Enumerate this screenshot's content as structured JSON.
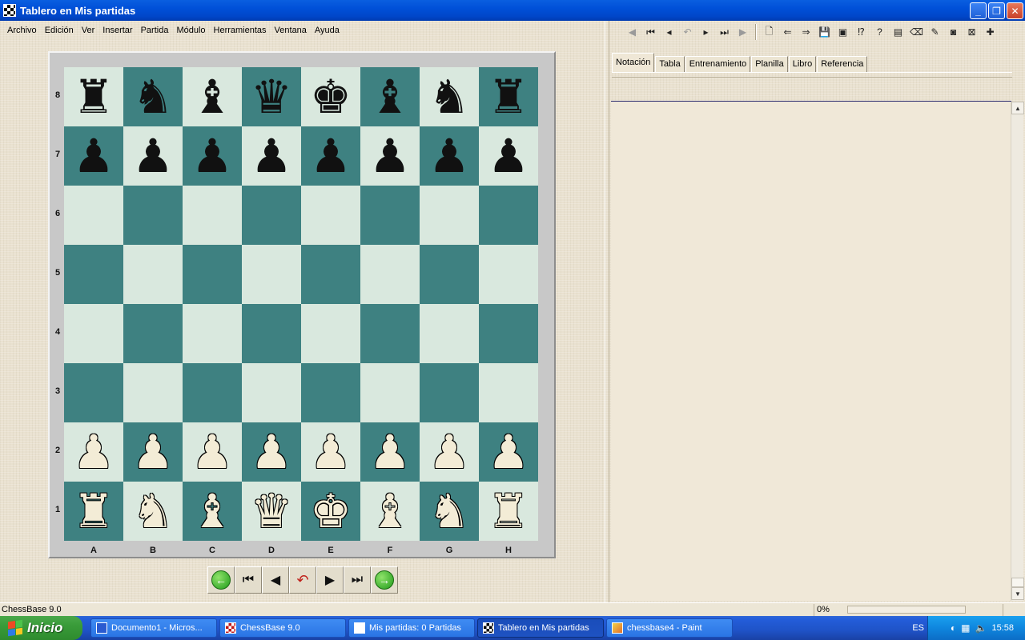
{
  "window": {
    "title": "Tablero en Mis partidas"
  },
  "menu": [
    "Archivo",
    "Edición",
    "Ver",
    "Insertar",
    "Partida",
    "Módulo",
    "Herramientas",
    "Ventana",
    "Ayuda"
  ],
  "board": {
    "ranks": [
      "8",
      "7",
      "6",
      "5",
      "4",
      "3",
      "2",
      "1"
    ],
    "files": [
      "A",
      "B",
      "C",
      "D",
      "E",
      "F",
      "G",
      "H"
    ],
    "position": [
      [
        "r",
        "n",
        "b",
        "q",
        "k",
        "b",
        "n",
        "r"
      ],
      [
        "p",
        "p",
        "p",
        "p",
        "p",
        "p",
        "p",
        "p"
      ],
      [
        "",
        "",
        "",
        "",
        "",
        "",
        "",
        ""
      ],
      [
        "",
        "",
        "",
        "",
        "",
        "",
        "",
        ""
      ],
      [
        "",
        "",
        "",
        "",
        "",
        "",
        "",
        ""
      ],
      [
        "",
        "",
        "",
        "",
        "",
        "",
        "",
        ""
      ],
      [
        "P",
        "P",
        "P",
        "P",
        "P",
        "P",
        "P",
        "P"
      ],
      [
        "R",
        "N",
        "B",
        "Q",
        "K",
        "B",
        "N",
        "R"
      ]
    ],
    "light_color": "#d9e8de",
    "dark_color": "#3e8181"
  },
  "tabs": [
    "Notación",
    "Tabla",
    "Entrenamiento",
    "Planilla",
    "Libro",
    "Referencia"
  ],
  "active_tab": 0,
  "status": {
    "text": "ChessBase 9.0",
    "progress_label": "0%",
    "progress": 0
  },
  "taskbar": {
    "start_label": "Inicio",
    "items": [
      {
        "label": "Documento1 - Micros...",
        "icon": "word-icon",
        "active": false
      },
      {
        "label": "ChessBase 9.0",
        "icon": "chessbase-icon",
        "active": false
      },
      {
        "label": "Mis partidas:  0 Partidas",
        "icon": "database-icon",
        "active": false
      },
      {
        "label": "Tablero en Mis partidas",
        "icon": "board-icon",
        "active": true
      },
      {
        "label": "chessbase4 - Paint",
        "icon": "paint-icon",
        "active": false
      }
    ],
    "language": "ES",
    "clock": "15:58"
  }
}
